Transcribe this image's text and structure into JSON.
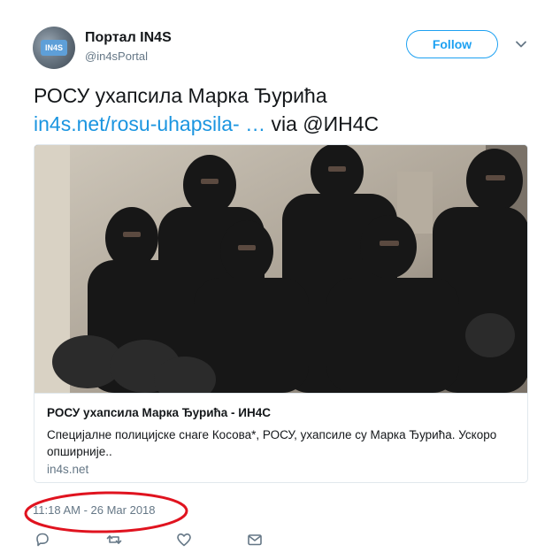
{
  "author": {
    "name": "Портал IN4S",
    "handle": "@in4sPortal",
    "avatar_text": "IN4S"
  },
  "follow_label": "Follow",
  "menu_icon": "chevron-down-icon",
  "tweet": {
    "text_main": "РОСУ ухапсила Марка Ђурића",
    "link_text": "in4s.net/rosu-uhapsila- …",
    "via_text": " via @ИН4С"
  },
  "card": {
    "title": "РОСУ ухапсила Марка Ђурића - ИН4С",
    "description": "Специјалне полицијске снаге Косова*, РОСУ, ухапсиле су Марка Ђурића. Ускоро опширније..",
    "domain": "in4s.net"
  },
  "timestamp": "11:18 AM - 26 Mar 2018",
  "highlight_color": "#e0131f",
  "accent_color": "#1da1f2",
  "actions": {
    "reply_icon": "reply-icon",
    "retweet_icon": "retweet-icon",
    "like_icon": "heart-icon",
    "dm_icon": "envelope-icon"
  }
}
